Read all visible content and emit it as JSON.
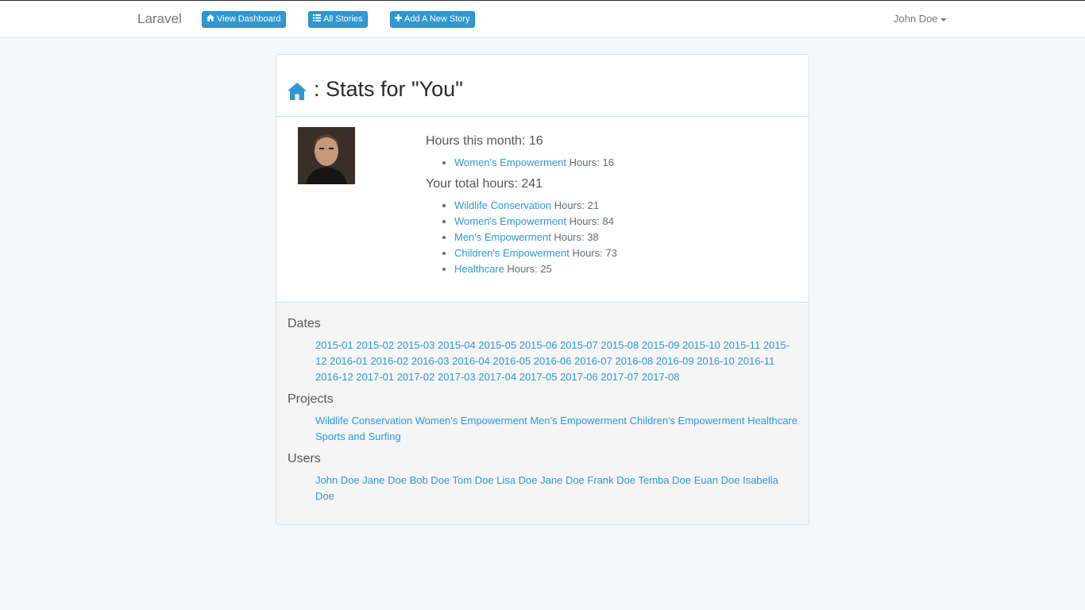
{
  "navbar": {
    "brand": "Laravel",
    "buttons": [
      {
        "label": "View Dashboard",
        "icon": "home-icon"
      },
      {
        "label": "All Stories",
        "icon": "list-icon"
      },
      {
        "label": "Add A New Story",
        "icon": "plus-icon"
      }
    ],
    "user": "John Doe"
  },
  "panel": {
    "title": ": Stats for \"You\"",
    "month_heading": "Hours this month: 16",
    "month_items": [
      {
        "project": "Women's Empowerment",
        "hours": "Hours: 16"
      }
    ],
    "total_heading": "Your total hours: 241",
    "total_items": [
      {
        "project": "Wildlife Conservation",
        "hours": "Hours: 21"
      },
      {
        "project": "Women's Empowerment",
        "hours": "Hours: 84"
      },
      {
        "project": "Men's Empowerment",
        "hours": "Hours: 38"
      },
      {
        "project": "Children's Empowerment",
        "hours": "Hours: 73"
      },
      {
        "project": "Healthcare",
        "hours": "Hours: 25"
      }
    ]
  },
  "footer": {
    "dates_heading": "Dates",
    "dates": [
      "2015-01",
      "2015-02",
      "2015-03",
      "2015-04",
      "2015-05",
      "2015-06",
      "2015-07",
      "2015-08",
      "2015-09",
      "2015-10",
      "2015-11",
      "2015-12",
      "2016-01",
      "2016-02",
      "2016-03",
      "2016-04",
      "2016-05",
      "2016-06",
      "2016-07",
      "2016-08",
      "2016-09",
      "2016-10",
      "2016-11",
      "2016-12",
      "2017-01",
      "2017-02",
      "2017-03",
      "2017-04",
      "2017-05",
      "2017-06",
      "2017-07",
      "2017-08"
    ],
    "projects_heading": "Projects",
    "projects": [
      "Wildlife Conservation",
      "Women's Empowerment",
      "Men's Empowerment",
      "Children's Empowerment",
      "Healthcare",
      "Sports and Surfing"
    ],
    "users_heading": "Users",
    "users": [
      "John Doe",
      "Jane Doe",
      "Bob Doe",
      "Tom Doe",
      "Lisa Doe",
      "Jane Doe",
      "Frank Doe",
      "Temba Doe",
      "Euan Doe",
      "Isabella Doe"
    ]
  },
  "colors": {
    "accent": "#3097d1",
    "background": "#f5f8fa",
    "footer_bg": "#f5f5f5"
  }
}
